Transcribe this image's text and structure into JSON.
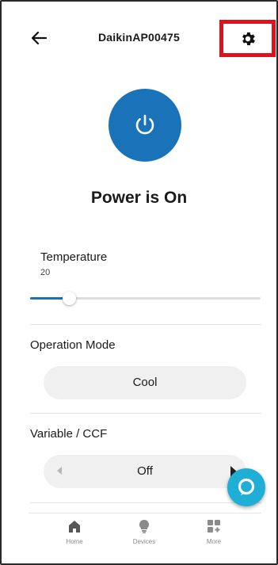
{
  "header": {
    "title": "DaikinAP00475",
    "back_icon": "arrow-left-icon",
    "settings_icon": "gear-icon"
  },
  "power": {
    "icon": "power-icon",
    "status_text": "Power is On",
    "color": "#1a73b8"
  },
  "temperature": {
    "label": "Temperature",
    "value": "20",
    "slider_level": 0.17
  },
  "operation_mode": {
    "label": "Operation Mode",
    "selected": "Cool"
  },
  "variable_ccf": {
    "label": "Variable / CCF",
    "selected": "Off"
  },
  "alexa": {
    "icon": "alexa-icon",
    "color": "#1faed6"
  },
  "nav": {
    "items": [
      {
        "label": "Home",
        "icon": "home-icon"
      },
      {
        "label": "Devices",
        "icon": "lightbulb-icon"
      },
      {
        "label": "More",
        "icon": "grid-plus-icon"
      }
    ]
  },
  "colors": {
    "accent": "#1a73b8",
    "highlight_box": "#e0101d"
  }
}
